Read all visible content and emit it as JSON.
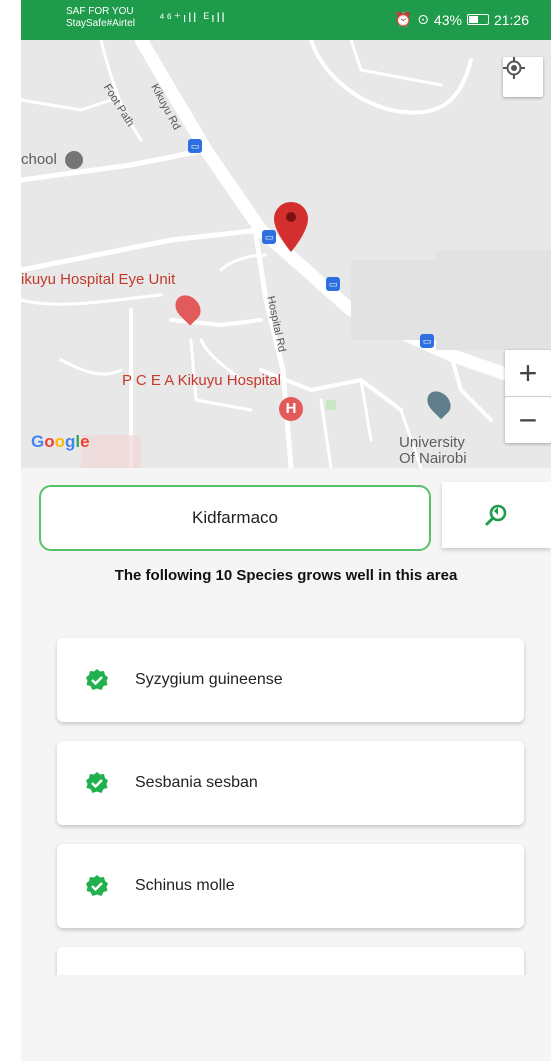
{
  "status_bar": {
    "carrier_line1": "SAF FOR YOU",
    "carrier_line2": "StaySafe#Airtel",
    "signal_text": "⁴⁶⁺ıll ᴱıll",
    "battery": "43%",
    "battery_level": 0.43,
    "time": "21:26"
  },
  "map": {
    "labels": {
      "school": "chool",
      "eye_unit": "ikuyu Hospital Eye Unit",
      "hospital": "P C E A Kikuyu Hospital",
      "university_line1": "University",
      "university_line2": "Of Nairobi",
      "foot_path": "Foot Path",
      "kikuyu_rd": "Kikuyu Rd",
      "hospital_rd": "Hospital Rd"
    },
    "google_logo": "Google",
    "zoom_in": "+",
    "zoom_out": "−",
    "colors": {
      "pin": "#d32f2f",
      "hospital_marker": "#e35a5a",
      "bus": "#2d6fe0"
    }
  },
  "search": {
    "value": "Kidfarmaco"
  },
  "info_text": "The following 10 Species grows well in this area",
  "species": [
    {
      "name": "Syzygium guineense"
    },
    {
      "name": "Sesbania sesban"
    },
    {
      "name": "Schinus molle"
    },
    {
      "name": ""
    }
  ],
  "colors": {
    "accent": "#1f9c4b",
    "check": "#20b04d",
    "search_border": "#57c26b"
  }
}
